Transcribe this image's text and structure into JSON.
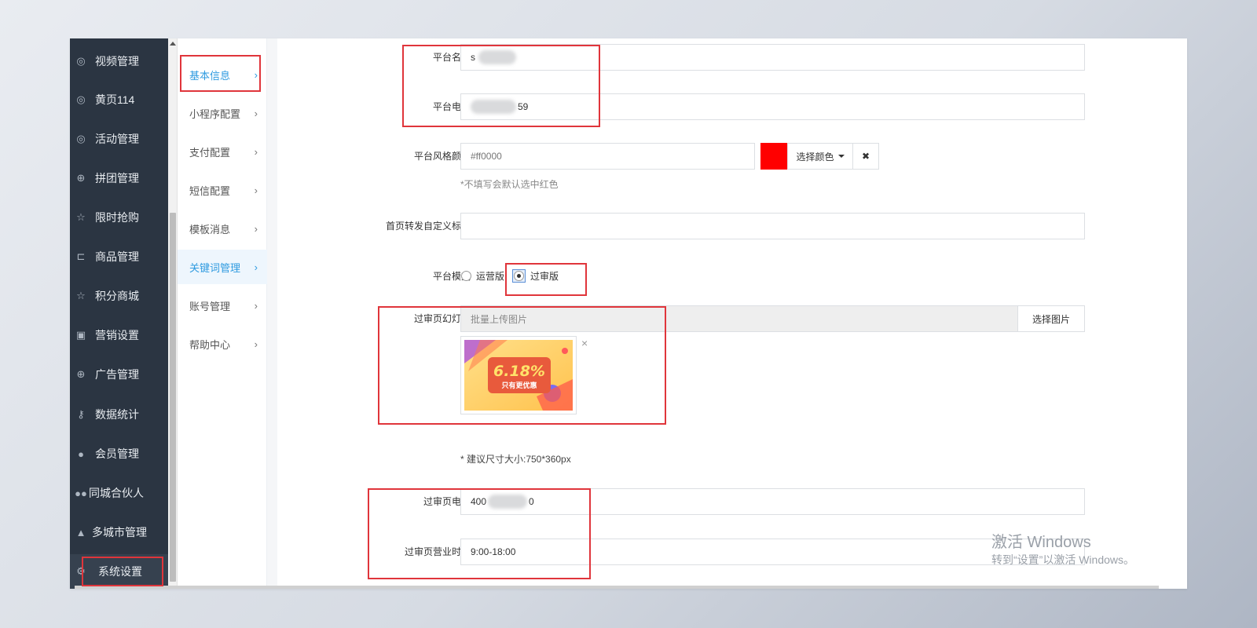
{
  "sidebar": {
    "items": [
      {
        "label": "视频管理",
        "icon": "compass-icon"
      },
      {
        "label": "黄页114",
        "icon": "compass-icon"
      },
      {
        "label": "活动管理",
        "icon": "compass-icon"
      },
      {
        "label": "拼团管理",
        "icon": "lifebuoy-icon"
      },
      {
        "label": "限时抢购",
        "icon": "star-icon"
      },
      {
        "label": "商品管理",
        "icon": "cart-icon"
      },
      {
        "label": "积分商城",
        "icon": "star-icon"
      },
      {
        "label": "营销设置",
        "icon": "gift-icon"
      },
      {
        "label": "广告管理",
        "icon": "lifebuoy-icon"
      },
      {
        "label": "数据统计",
        "icon": "key-icon"
      },
      {
        "label": "会员管理",
        "icon": "user-icon"
      },
      {
        "label": "同城合伙人",
        "icon": "users-icon"
      },
      {
        "label": "多城市管理",
        "icon": "graduation-cap-icon"
      },
      {
        "label": "系统设置",
        "icon": "gear-icon"
      }
    ]
  },
  "submenu": {
    "items": [
      {
        "label": "基本信息"
      },
      {
        "label": "小程序配置"
      },
      {
        "label": "支付配置"
      },
      {
        "label": "短信配置"
      },
      {
        "label": "模板消息"
      },
      {
        "label": "关键词管理"
      },
      {
        "label": "账号管理"
      },
      {
        "label": "帮助中心"
      }
    ],
    "chevron": "›"
  },
  "form": {
    "platform_name": {
      "label": "平台名称",
      "value_visible": "s"
    },
    "platform_phone": {
      "label": "平台电话",
      "value_visible": "59"
    },
    "style_color": {
      "label": "平台风格颜色",
      "value": "#ff0000",
      "swatch": "#ff0000",
      "choose_label": "选择颜色",
      "clear_label": "✖",
      "hint": "*不填写会默认选中红色"
    },
    "share_title": {
      "label": "首页转发自定义标题",
      "value": ""
    },
    "mode": {
      "label": "平台模式",
      "options": [
        {
          "label": "运营版",
          "checked": false
        },
        {
          "label": "过审版",
          "checked": true
        }
      ]
    },
    "slides": {
      "label": "过审页幻灯片",
      "placeholder": "批量上传图片",
      "button": "选择图片",
      "remove": "×",
      "image_text": "6.18%",
      "image_subtext": "只有更优惠",
      "hint": "* 建议尺寸大小:750*360px"
    },
    "review_phone": {
      "label": "过审页电话",
      "prefix": "400",
      "suffix": "0"
    },
    "review_hours": {
      "label": "过审页营业时间",
      "value": "9:00-18:00"
    }
  },
  "watermark": {
    "line1": "激活 Windows",
    "line2": "转到“设置”以激活 Windows。"
  }
}
